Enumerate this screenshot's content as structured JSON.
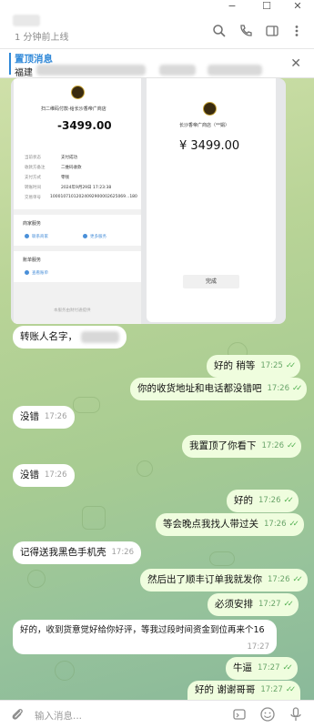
{
  "window": {
    "minimize_icon": "minimize-icon",
    "maximize_icon": "maximize-icon",
    "close_icon": "close-icon"
  },
  "header": {
    "status": "1 分钟前上线",
    "icons": [
      "search-icon",
      "phone-icon",
      "sidebar-panel-icon",
      "more-vertical-icon"
    ]
  },
  "pinned": {
    "title": "置顶消息",
    "preview_prefix": "福建",
    "close_symbol": "✕"
  },
  "receipt_left": {
    "merchant": "扫二维码付款-给长沙香帝广商店",
    "amount": "-3499.00",
    "rows": [
      {
        "label": "当前状态",
        "value": "支付成功"
      },
      {
        "label": "收款方备注",
        "value": "二维码收款"
      },
      {
        "label": "支付方式",
        "value": "零钱"
      },
      {
        "label": "转账时间",
        "value": "2024年9月29日 17:23:38"
      },
      {
        "label": "交易单号",
        "value": "10001071012024092900002625069...180"
      }
    ],
    "section_merchant": "商家服务",
    "link_contact": "联系商家",
    "link_more": "更多服务",
    "section_account": "账单服务",
    "link_bill": "查看账单",
    "footer": "本服务由财付通提供"
  },
  "receipt_right": {
    "merchant": "长沙香帝广商店（**娟）",
    "amount": "¥ 3499.00",
    "done": "完成"
  },
  "messages": [
    {
      "dir": "in",
      "text": "转账人名字，",
      "time": ""
    },
    {
      "dir": "out",
      "text": "好的 稍等",
      "time": "17:25"
    },
    {
      "dir": "out",
      "text": "你的收货地址和电话都没错吧",
      "time": "17:26"
    },
    {
      "dir": "in",
      "text": "没错",
      "time": "17:26"
    },
    {
      "dir": "out",
      "text": "我置顶了你看下",
      "time": "17:26"
    },
    {
      "dir": "in",
      "text": "没错",
      "time": "17:26"
    },
    {
      "dir": "out",
      "text": "好的",
      "time": "17:26"
    },
    {
      "dir": "out",
      "text": "等会晚点我找人带过关",
      "time": "17:26"
    },
    {
      "dir": "in",
      "text": "记得送我黑色手机壳",
      "time": "17:26"
    },
    {
      "dir": "out",
      "text": "然后出了顺丰订单我就发你",
      "time": "17:26"
    },
    {
      "dir": "out",
      "text": "必须安排",
      "time": "17:27"
    },
    {
      "dir": "in",
      "text": "好的，收到货意觉好给你好评，等我过段时间资金到位再来个16",
      "time": "17:27"
    },
    {
      "dir": "out",
      "text": "牛逼",
      "time": "17:27"
    },
    {
      "dir": "out",
      "text": "好的 谢谢哥哥",
      "time": "17:27"
    }
  ],
  "input": {
    "placeholder": "输入消息...",
    "icons": [
      "attach-icon",
      "command-icon",
      "emoji-icon",
      "microphone-icon"
    ]
  },
  "colors": {
    "accent": "#2f88d8",
    "incoming_bubble": "#ffffff",
    "outgoing_bubble": "#effdde",
    "read_ticks": "#4fae4e"
  }
}
